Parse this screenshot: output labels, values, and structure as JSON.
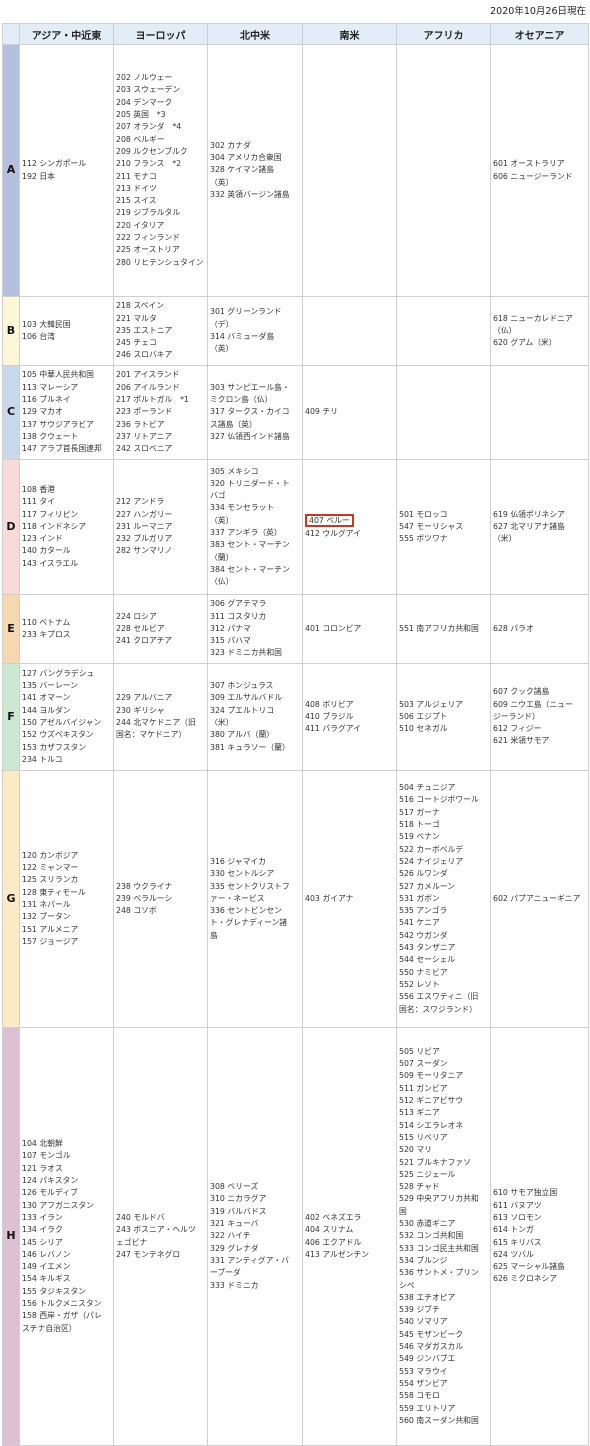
{
  "date": "2020年10月26日現在",
  "headers": [
    "アジア・中近東",
    "ヨーロッパ",
    "北中米",
    "南米",
    "アフリカ",
    "オセアニア"
  ],
  "rows": [
    {
      "group": "A",
      "color": "#b4c0de",
      "height": 252,
      "cells": [
        [
          "112 シンガポール",
          "192 日本"
        ],
        [
          "202 ノルウェー",
          "203 スウェーデン",
          "204 デンマーク",
          "205 英国　*3",
          "207 オランダ　*4",
          "208 ベルギー",
          "209 ルクセンブルク",
          "210 フランス　*2",
          "211 モナコ",
          "213 ドイツ",
          "215 スイス",
          "219 ジブラルタル",
          "220 イタリア",
          "222 フィンランド",
          "225 オーストリア",
          "280 リヒテンシュタイン"
        ],
        [
          "302 カナダ",
          "304 アメリカ合衆国",
          "328 ケイマン諸島",
          "（英）",
          "332 英領バージン諸島"
        ],
        [],
        [],
        [
          "601 オーストラリア",
          "606 ニュージーランド"
        ]
      ]
    },
    {
      "group": "B",
      "color": "#fdf6d8",
      "height": 69,
      "cells": [
        [
          "103 大韓民国",
          "106 台湾"
        ],
        [
          "218 スペイン",
          "221 マルタ",
          "235 エストニア",
          "245 チェコ",
          "246 スロバキア"
        ],
        [
          "301 グリーンランド",
          "（デ）",
          "314 バミューダ島",
          "（英）"
        ],
        [],
        [],
        [
          "618 ニューカレドニア",
          "（仏）",
          "620 グアム（米）"
        ]
      ]
    },
    {
      "group": "C",
      "color": "#cad8ec",
      "height": 94,
      "cells": [
        [
          "105 中華人民共和国",
          "113 マレーシア",
          "116 ブルネイ",
          "129 マカオ",
          "137 サウジアラビア",
          "138 クウェート",
          "147 アラブ首長国連邦"
        ],
        [
          "201 アイスランド",
          "206 アイルランド",
          "217 ポルトガル　*1",
          "223 ポーランド",
          "236 ラトビア",
          "237 リトアニア",
          "242 スロベニア"
        ],
        [
          "303 サンピエール島・",
          "ミクロン島（仏）",
          "317 タークス・カイコ",
          "ス諸島（英）",
          "327 仏領西インド諸島"
        ],
        [
          "409 チリ"
        ],
        [],
        []
      ]
    },
    {
      "group": "D",
      "color": "#f8dad8",
      "height": 135,
      "cells": [
        [
          "108 香港",
          "111 タイ",
          "117 フィリピン",
          "118 インドネシア",
          "123 インド",
          "140 カタール",
          "143 イスラエル"
        ],
        [
          "212 アンドラ",
          "227 ハンガリー",
          "231 ルーマニア",
          "232 ブルガリア",
          "282 サンマリノ"
        ],
        [
          "305 メキシコ",
          "320 トリニダード・ト",
          "バゴ",
          "334 モンセラット",
          "（英）",
          "337 アンギラ（英）",
          "383 セント・マーチン",
          "（蘭）",
          "384 セント・マーチン",
          "（仏）"
        ],
        [
          "407 ペルー",
          "412 ウルグアイ"
        ],
        [
          "501 モロッコ",
          "547 モーリシャス",
          "555 ボツワナ"
        ],
        [
          "619 仏領ポリネシア",
          "627 北マリアナ諸島",
          "（米）"
        ]
      ]
    },
    {
      "group": "E",
      "color": "#f6d8b0",
      "height": 69,
      "cells": [
        [
          "110 ベトナム",
          "233 キプロス"
        ],
        [
          "224 ロシア",
          "228 セルビア",
          "241 クロアチア"
        ],
        [
          "306 グアテマラ",
          "311 コスタリカ",
          "312 パナマ",
          "315 パハマ",
          "323 ドミニカ共和国"
        ],
        [
          "401 コロンビア"
        ],
        [
          "551 南アフリカ共和国"
        ],
        [
          "628 パラオ"
        ]
      ]
    },
    {
      "group": "F",
      "color": "#cce8d0",
      "height": 107,
      "cells": [
        [
          "127 バングラデシュ",
          "135 バーレーン",
          "141 オマーン",
          "144 ヨルダン",
          "150 アゼルバイジャン",
          "152 ウズベキスタン",
          "153 カザフスタン",
          "234 トルコ"
        ],
        [
          "229 アルバニア",
          "230 ギリシャ",
          "244 北マケドニア（旧",
          "国名：マケドニア）"
        ],
        [
          "307 ホンジュラス",
          "309 エルサルバドル",
          "324 プエルトリコ",
          "（米）",
          "380 アルバ（蘭）",
          "381 キュラソー（蘭）"
        ],
        [
          "408 ボリビア",
          "410 ブラジル",
          "411 パラグアイ"
        ],
        [
          "503 アルジェリア",
          "506 エジプト",
          "510 セネガル"
        ],
        [
          "607 クック諸島",
          "609 ニウエ島（ニュー",
          "ジーランド）",
          "612 フィジー",
          "621 米領サモア"
        ]
      ]
    },
    {
      "group": "G",
      "color": "#fdebc8",
      "height": 257,
      "cells": [
        [
          "120 カンボジア",
          "122 ミャンマー",
          "125 スリランカ",
          "128 東ティモール",
          "131 ネパール",
          "132 ブータン",
          "151 アルメニア",
          "157 ジョージア"
        ],
        [
          "238 ウクライナ",
          "239 ベラルーシ",
          "248 コソボ"
        ],
        [
          "316 ジャマイカ",
          "330 セントルシア",
          "335 セントクリストフ",
          "ァー・ネービス",
          "336 セントビンセン",
          "ト・グレナディーン諸",
          "島"
        ],
        [
          "403 ガイアナ"
        ],
        [
          "504 チュニジア",
          "516 コートジボワール",
          "517 ガーナ",
          "518 トーゴ",
          "519 ベナン",
          "522 カーボベルデ",
          "524 ナイジェリア",
          "526 ルワンダ",
          "527 カメルーン",
          "531 ガボン",
          "535 アンゴラ",
          "541 ケニア",
          "542 ウガンダ",
          "543 タンザニア",
          "544 セーシェル",
          "550 ナミビア",
          "552 レソト",
          "556 エスワティニ（旧",
          "国名：スワジランド）"
        ],
        [
          "602 パプアニューギニア"
        ]
      ]
    },
    {
      "group": "H",
      "color": "#dcc0d4",
      "height": 418,
      "cells": [
        [
          "104 北朝鮮",
          "107 モンゴル",
          "121 ラオス",
          "124 パキスタン",
          "126 モルディブ",
          "130 アフガニスタン",
          "133 イラン",
          "134 イラク",
          "145 シリア",
          "146 レバノン",
          "149 イエメン",
          "154 キルギス",
          "155 タジキスタン",
          "156 トルクメニスタン",
          "158 西岸・ガザ（パレ",
          "スチナ自治区）"
        ],
        [
          "240 モルドバ",
          "243 ボスニア・ヘルツ",
          "ェゴビナ",
          "247 モンテネグロ"
        ],
        [
          "308 ベリーズ",
          "310 ニカラグア",
          "319 バルバドス",
          "321 キューバ",
          "322 ハイチ",
          "329 グレナダ",
          "331 アンティグア・バ",
          "ーブーダ",
          "333 ドミニカ"
        ],
        [
          "402 ベネズエラ",
          "404 スリナム",
          "406 エクアドル",
          "413 アルゼンチン"
        ],
        [
          "505 リビア",
          "507 スーダン",
          "509 モーリタニア",
          "511 ガンビア",
          "512 ギニアビサウ",
          "513 ギニア",
          "514 シエラレオネ",
          "515 リベリア",
          "520 マリ",
          "521 ブルキナファソ",
          "525 ニジェール",
          "528 チャド",
          "529 中央アフリカ共和",
          "国",
          "530 赤道ギニア",
          "532 コンゴ共和国",
          "533 コンゴ民主共和国",
          "534 ブルンジ",
          "536 サントメ・プリン",
          "シペ",
          "538 エチオピア",
          "539 ジブチ",
          "540 ソマリア",
          "545 モザンビーク",
          "546 マダガスカル",
          "549 ジンバブエ",
          "553 マラウイ",
          "554 ザンビア",
          "558 コモロ",
          "559 エリトリア",
          "560 南スーダン共和国"
        ],
        [
          "610 サモア独立国",
          "611 バヌアツ",
          "613 ソロモン",
          "614 トンガ",
          "615 キリバス",
          "624 ツバル",
          "625 マーシャル諸島",
          "626 ミクロネシア"
        ]
      ]
    }
  ]
}
